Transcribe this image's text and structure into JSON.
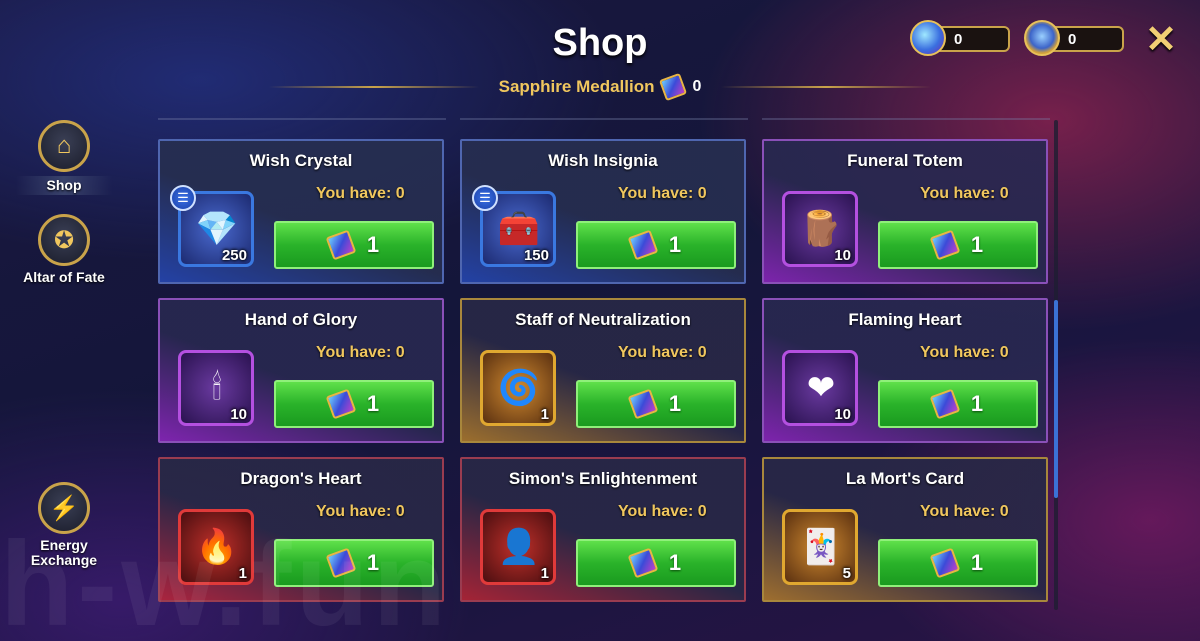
{
  "header": {
    "title": "Shop",
    "currency_label": "Sapphire Medallion",
    "currency_count": "0"
  },
  "top_currencies": [
    {
      "icon": "energy-gem-icon",
      "value": "0"
    },
    {
      "icon": "star-medal-icon",
      "value": "0"
    }
  ],
  "close_label": "✕",
  "sidebar": {
    "items": [
      {
        "label": "Shop",
        "icon": "shop-icon"
      },
      {
        "label": "Altar of Fate",
        "icon": "star-icon"
      },
      {
        "label": "Energy Exchange",
        "icon": "lightning-icon"
      }
    ]
  },
  "items": [
    {
      "name": "Wish Crystal",
      "have": "You have: 0",
      "qty": "250",
      "price": "1",
      "rarity": "blue"
    },
    {
      "name": "Wish Insignia",
      "have": "You have: 0",
      "qty": "150",
      "price": "1",
      "rarity": "blue"
    },
    {
      "name": "Funeral Totem",
      "have": "You have: 0",
      "qty": "10",
      "price": "1",
      "rarity": "purple"
    },
    {
      "name": "Hand of Glory",
      "have": "You have: 0",
      "qty": "10",
      "price": "1",
      "rarity": "purple"
    },
    {
      "name": "Staff of Neutralization",
      "have": "You have: 0",
      "qty": "1",
      "price": "1",
      "rarity": "gold"
    },
    {
      "name": "Flaming Heart",
      "have": "You have: 0",
      "qty": "10",
      "price": "1",
      "rarity": "purple"
    },
    {
      "name": "Dragon's Heart",
      "have": "You have: 0",
      "qty": "1",
      "price": "1",
      "rarity": "red"
    },
    {
      "name": "Simon's Enlightenment",
      "have": "You have: 0",
      "qty": "1",
      "price": "1",
      "rarity": "red"
    },
    {
      "name": "La Mort's Card",
      "have": "You have: 0",
      "qty": "5",
      "price": "1",
      "rarity": "gold"
    }
  ],
  "watermark": "h-w.fun"
}
